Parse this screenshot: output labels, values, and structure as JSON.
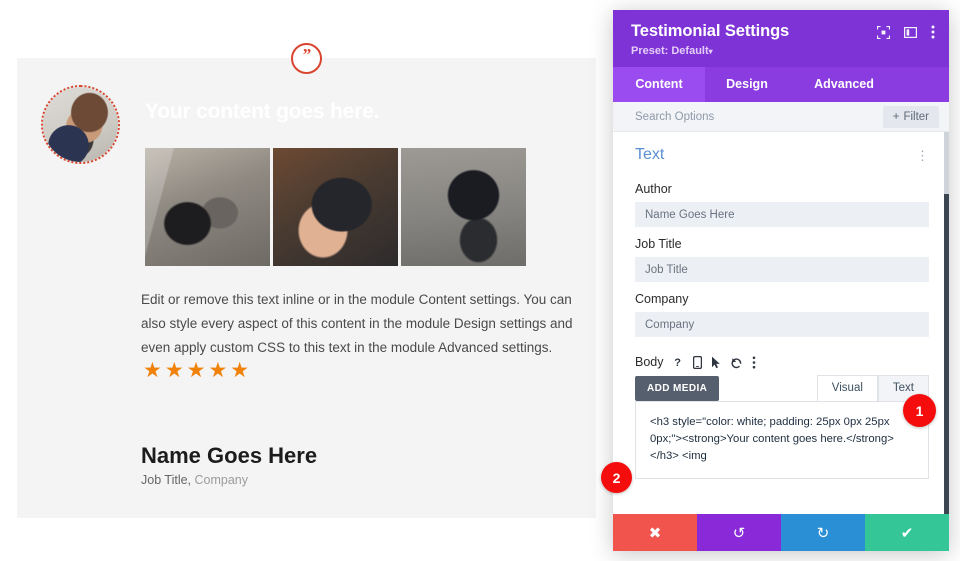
{
  "preview": {
    "quote_icon": "quote-mark-icon",
    "hero_title": "Your content goes here.",
    "body_copy": "Edit or remove this text inline or in the module Content settings. You can also style every aspect of this content in the module Design settings and even apply custom CSS to this text in the module Advanced settings.",
    "stars": "★★★★★",
    "person_name": "Name Goes Here",
    "person_job": "Job Title,",
    "person_company": "Company",
    "photos": [
      {
        "alt": "scooter-handlebar-photo"
      },
      {
        "alt": "hands-holding-phone-photo"
      },
      {
        "alt": "person-riding-scooter-photo"
      }
    ],
    "colors": {
      "accent_red": "#d9452f",
      "star_orange": "#f0820a",
      "panel_bg": "#f4f4f4"
    }
  },
  "modal": {
    "title": "Testimonial Settings",
    "preset_label": "Preset: Default",
    "preset_caret": "▾",
    "header_icons": [
      "fullscreen-icon",
      "split-view-icon",
      "kebab-menu-icon"
    ],
    "tabs": [
      {
        "label": "Content",
        "active": true
      },
      {
        "label": "Design",
        "active": false
      },
      {
        "label": "Advanced",
        "active": false
      }
    ],
    "search": {
      "placeholder": "Search Options",
      "filter_label": "Filter",
      "filter_plus": "+"
    },
    "section": {
      "title": "Text",
      "kebab": "⋮"
    },
    "fields": [
      {
        "label": "Author",
        "value": "Name Goes Here",
        "placeholder": "Name Goes Here"
      },
      {
        "label": "Job Title",
        "value": "Job Title",
        "placeholder": "Job Title"
      },
      {
        "label": "Company",
        "value": "Company",
        "placeholder": "Company"
      }
    ],
    "body": {
      "label": "Body",
      "icons": [
        "help-icon",
        "mobile-icon",
        "cursor-icon",
        "reset-icon",
        "kebab-menu-icon"
      ],
      "add_media_label": "ADD MEDIA",
      "editor_tabs": [
        {
          "label": "Visual",
          "active": false
        },
        {
          "label": "Text",
          "active": true
        }
      ],
      "code": "<h3 style=\"color: white; padding: 25px 0px 25px 0px;\"><strong>Your content goes here.</strong></h3>\n<img"
    },
    "footer_buttons": [
      {
        "name": "cancel",
        "glyph": "✖",
        "color": "#f0544c"
      },
      {
        "name": "undo",
        "glyph": "↺",
        "color": "#8a29d8"
      },
      {
        "name": "redo",
        "glyph": "↻",
        "color": "#2a8fd4"
      },
      {
        "name": "save",
        "glyph": "✔",
        "color": "#34c697"
      }
    ],
    "colors": {
      "header_purple": "#7e33d6",
      "tab_bar": "#8a3ce0",
      "tab_active": "#9a4cf0",
      "section_blue": "#5b8fd4"
    }
  },
  "annotations": [
    {
      "number": "1"
    },
    {
      "number": "2"
    }
  ]
}
